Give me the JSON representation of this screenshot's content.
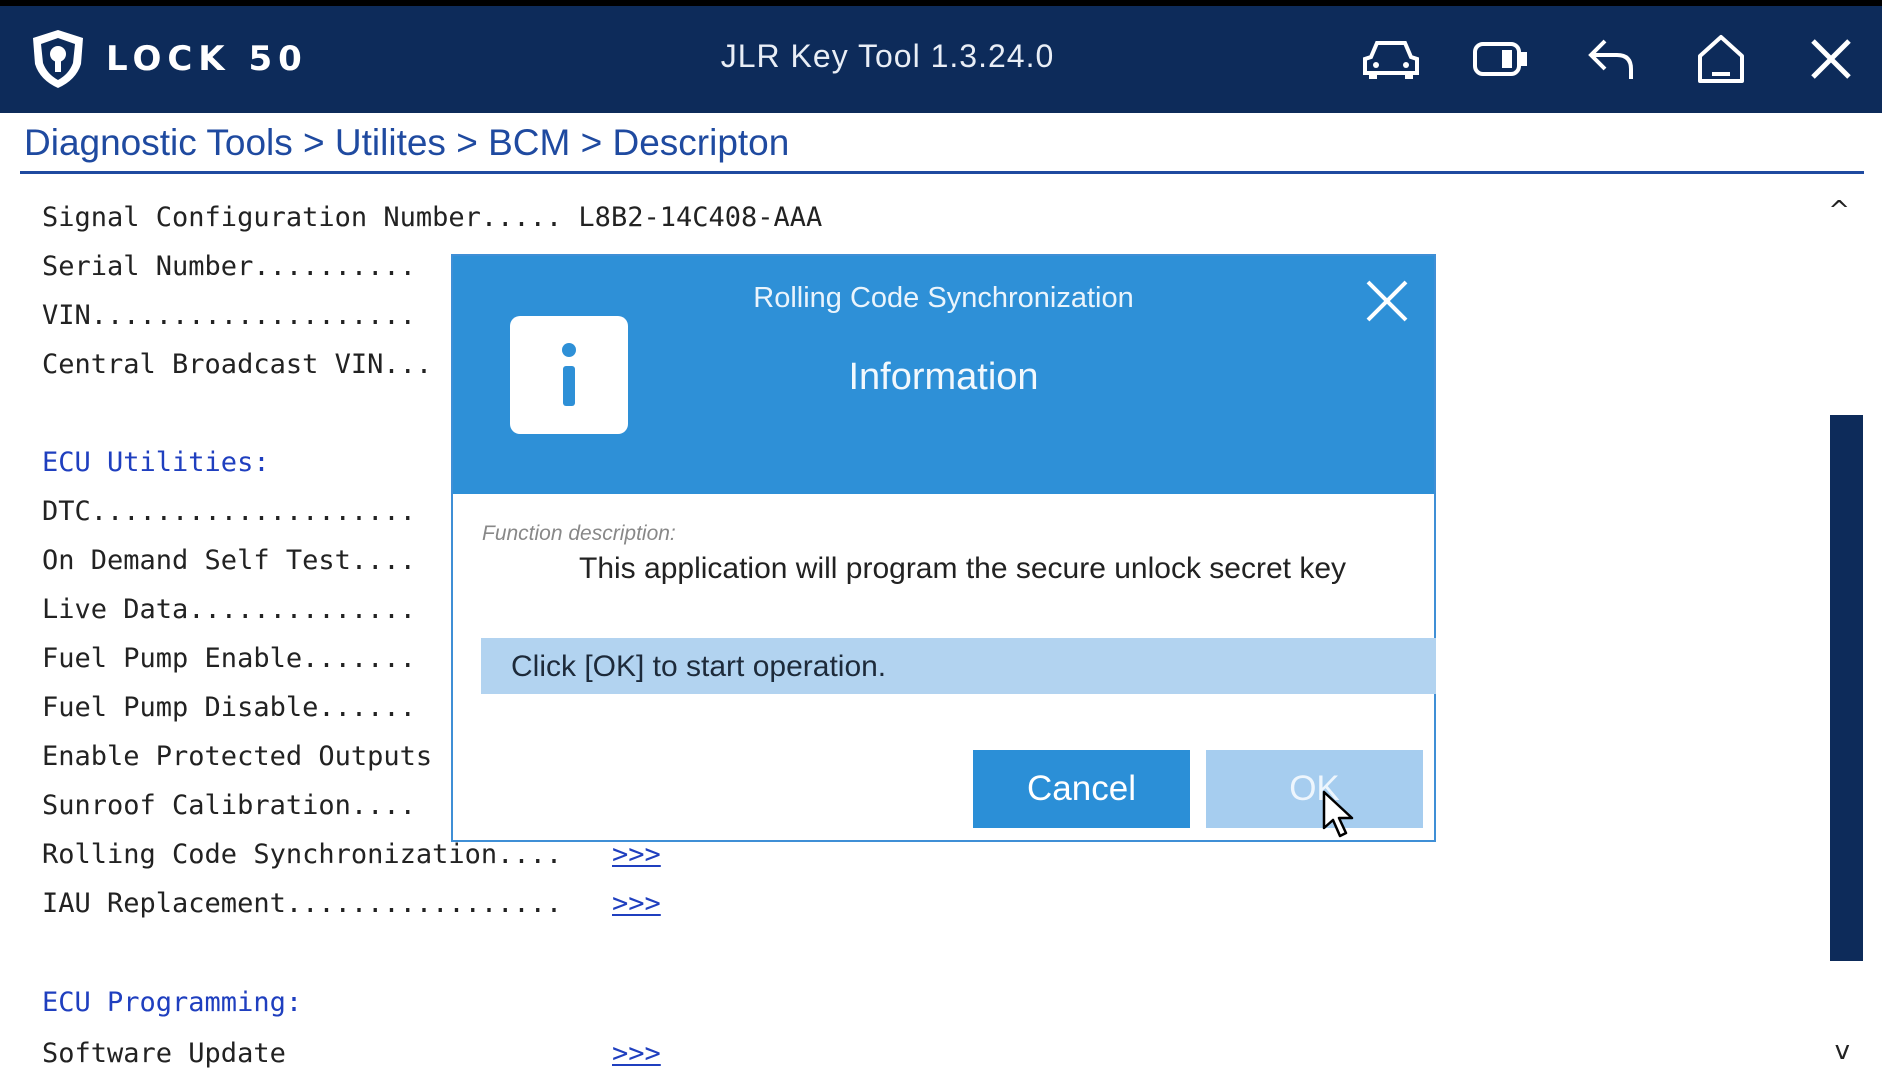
{
  "app": {
    "logo_text": "LOCK 50",
    "title": "JLR Key Tool 1.3.24.0",
    "toolbar_icons": [
      "car-icon",
      "battery-icon",
      "back-icon",
      "home-icon",
      "close-icon"
    ]
  },
  "breadcrumb": "Diagnostic Tools > Utilites > BCM > Descripton",
  "content": {
    "lines": [
      "Signal Configuration Number..... L8B2-14C408-AAA",
      "Serial Number..........",
      "VIN....................",
      "Central Broadcast VIN...",
      "",
      "ECU Utilities:",
      "DTC....................",
      "On Demand Self Test....",
      "Live Data..............",
      "Fuel Pump Enable.......",
      "Fuel Pump Disable......",
      "Enable Protected Outputs",
      "Sunroof Calibration....",
      "Rolling Code Synchronization....",
      "IAU Replacement.................",
      "",
      "ECU Programming:",
      "Software Update"
    ],
    "links": {
      "rolling_code": ">>>",
      "iau": ">>>",
      "software_update": ">>>"
    }
  },
  "dialog": {
    "title": "Rolling Code Synchronization",
    "subtitle": "Information",
    "icon": "info-icon",
    "description_label": "Function description:",
    "description": "This application will program the secure unlock secret key",
    "banner": "Click [OK] to start operation.",
    "cancel_label": "Cancel",
    "ok_label": "OK"
  },
  "colors": {
    "titlebar": "#0d2b5a",
    "accent": "#2e90d7",
    "link": "#1f3fbf"
  }
}
